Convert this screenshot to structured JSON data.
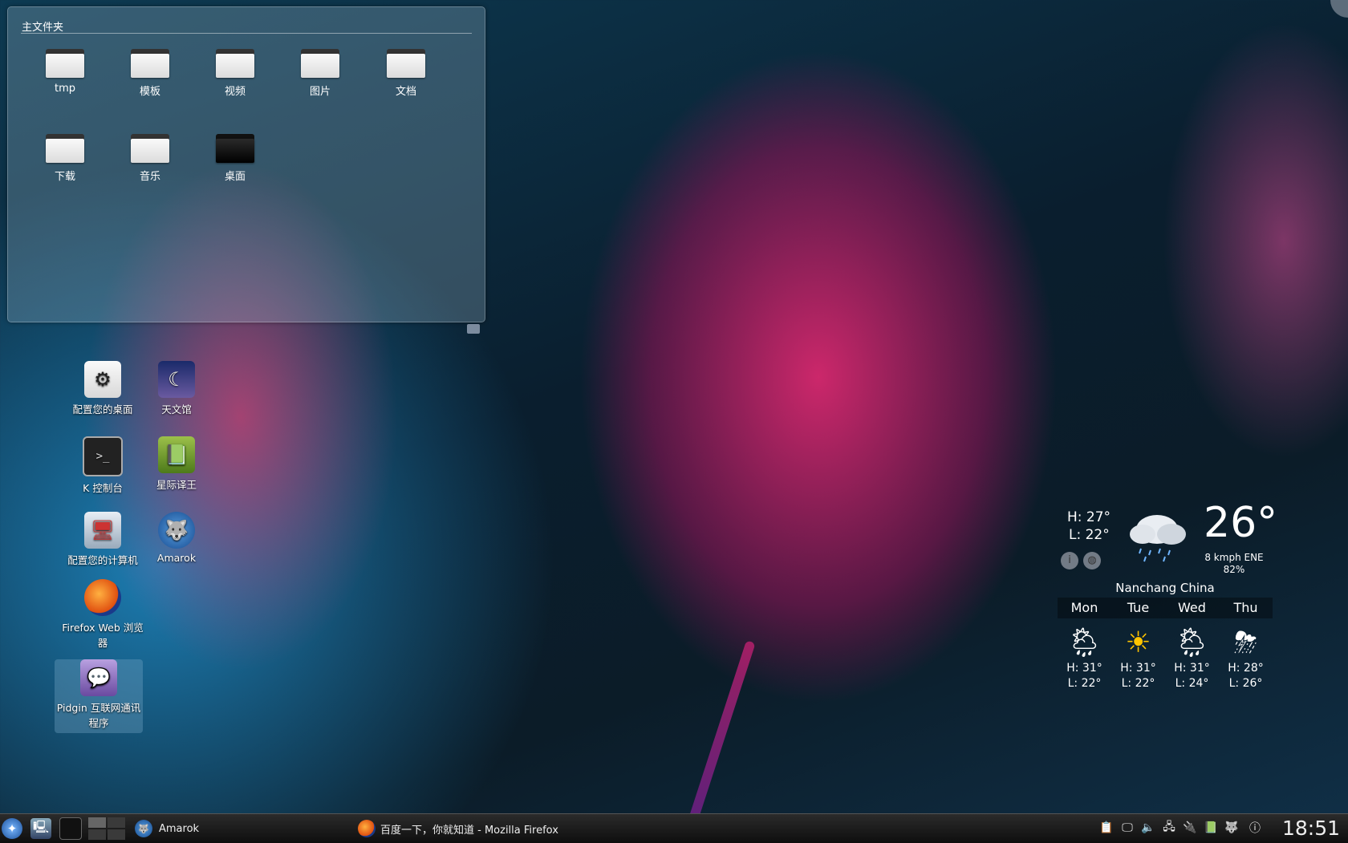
{
  "folder_view": {
    "title": "主文件夹",
    "items": [
      {
        "label": "tmp"
      },
      {
        "label": "模板"
      },
      {
        "label": "视频"
      },
      {
        "label": "图片"
      },
      {
        "label": "文档"
      },
      {
        "label": "下载"
      },
      {
        "label": "音乐"
      },
      {
        "label": "桌面"
      }
    ]
  },
  "desktop_icons": [
    {
      "label": "配置您的桌面"
    },
    {
      "label": "天文馆"
    },
    {
      "label": "K 控制台"
    },
    {
      "label": "星际译王"
    },
    {
      "label": "配置您的计算机"
    },
    {
      "label": "Amarok"
    },
    {
      "label": "Firefox Web 浏览器"
    },
    {
      "label": "Pidgin 互联网通讯程序"
    }
  ],
  "weather": {
    "high": "H: 27°",
    "low": "L: 22°",
    "temperature": "26°",
    "wind": "8 kmph ENE",
    "humidity": "82%",
    "location": "Nanchang China",
    "days": [
      "Mon",
      "Tue",
      "Wed",
      "Thu"
    ],
    "forecast": [
      {
        "high": "H: 31°",
        "low": "L: 22°",
        "icon": "sun-cloud-rain-icon"
      },
      {
        "high": "H: 31°",
        "low": "L: 22°",
        "icon": "sun-icon"
      },
      {
        "high": "H: 31°",
        "low": "L: 24°",
        "icon": "sun-cloud-rain-icon"
      },
      {
        "high": "H: 28°",
        "low": "L: 26°",
        "icon": "thunderstorm-icon"
      }
    ]
  },
  "taskbar": {
    "task_amarok": "Amarok",
    "task_firefox": "百度一下，你就知道 - Mozilla Firefox",
    "clock": "18:51"
  }
}
